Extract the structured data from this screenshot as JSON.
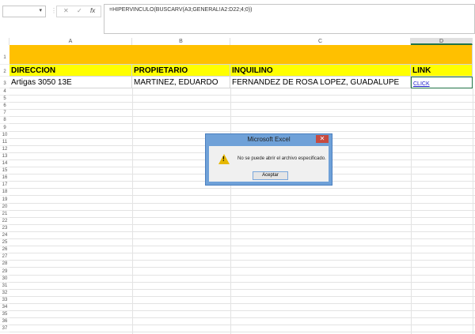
{
  "formula_bar": {
    "name_box": "",
    "formula": "=HIPERVINCULO(BUSCARV(A3;GENERAL!A2:D22;4;0))",
    "cancel": "✕",
    "enter": "✓",
    "fx": "fx"
  },
  "columns": [
    "A",
    "B",
    "C",
    "D"
  ],
  "rows": [
    "1",
    "2",
    "3",
    "4",
    "5",
    "6",
    "7",
    "8",
    "9",
    "10",
    "11",
    "12",
    "13",
    "14",
    "15",
    "16",
    "17",
    "18",
    "19",
    "20",
    "21",
    "22",
    "23",
    "24",
    "25",
    "26",
    "27",
    "28",
    "29",
    "30",
    "31",
    "32",
    "33",
    "34",
    "35",
    "36",
    "37"
  ],
  "headers": [
    "DIRECCION",
    "PROPIETARIO",
    "INQUILINO",
    "LINK"
  ],
  "row3": [
    "Artigas 3050 13E",
    "MARTINEZ, EDUARDO",
    "FERNANDEZ DE ROSA LOPEZ, GUADALUPE",
    "CLICK"
  ],
  "dialog": {
    "title": "Microsoft Excel",
    "message": "No se puede abrir el archivo especificado.",
    "ok": "Aceptar",
    "close": "✕",
    "warn": "!"
  },
  "colors": {
    "banner": "#ffc000",
    "header": "#ffff00",
    "link": "#1f1fcc"
  }
}
